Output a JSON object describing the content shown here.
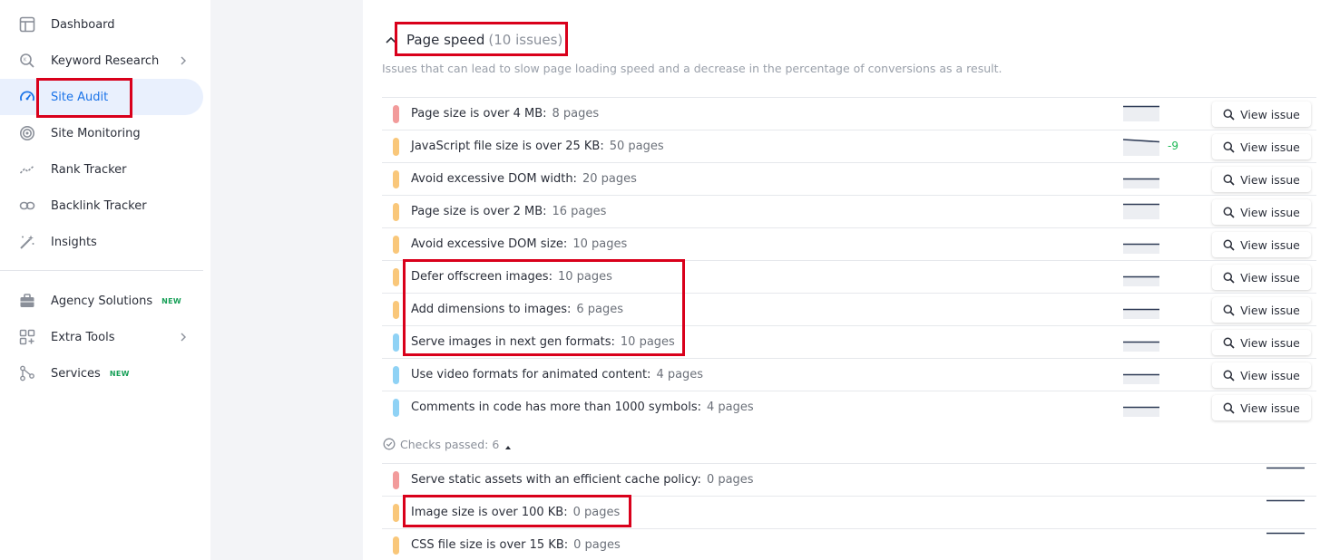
{
  "sidebar": {
    "items": [
      {
        "label": "Dashboard",
        "icon": "table-icon"
      },
      {
        "label": "Keyword Research",
        "icon": "keyword-search-icon",
        "chevron": true
      },
      {
        "label": "Site Audit",
        "icon": "speedometer-icon",
        "active": true
      },
      {
        "label": "Site Monitoring",
        "icon": "target-icon"
      },
      {
        "label": "Rank Tracker",
        "icon": "trend-line-icon"
      },
      {
        "label": "Backlink Tracker",
        "icon": "link-icon"
      },
      {
        "label": "Insights",
        "icon": "magic-wand-icon"
      }
    ],
    "items2": [
      {
        "label": "Agency Solutions",
        "icon": "briefcase-icon",
        "badge": "NEW"
      },
      {
        "label": "Extra Tools",
        "icon": "apps-icon",
        "chevron": true
      },
      {
        "label": "Services",
        "icon": "nodes-icon",
        "badge": "NEW"
      }
    ]
  },
  "section": {
    "title": "Page speed",
    "count": "(10 issues)",
    "description": "Issues that can lead to slow page loading speed and a decrease in the percentage of conversions as a result."
  },
  "issues": [
    {
      "text": "Page size is over 4 MB:",
      "pages": "8 pages",
      "severity": "red",
      "trend": "flat-high",
      "delta": ""
    },
    {
      "text": "JavaScript file size is over 25 KB:",
      "pages": "50 pages",
      "severity": "orange",
      "trend": "down-slight",
      "delta": "-9"
    },
    {
      "text": "Avoid excessive DOM width:",
      "pages": "20 pages",
      "severity": "orange",
      "trend": "flat-mid",
      "delta": ""
    },
    {
      "text": "Page size is over 2 MB:",
      "pages": "16 pages",
      "severity": "orange",
      "trend": "flat-high",
      "delta": ""
    },
    {
      "text": "Avoid excessive DOM size:",
      "pages": "10 pages",
      "severity": "orange",
      "trend": "flat-mid",
      "delta": ""
    },
    {
      "text": "Defer offscreen images:",
      "pages": "10 pages",
      "severity": "orange",
      "trend": "flat-mid",
      "delta": ""
    },
    {
      "text": "Add dimensions to images:",
      "pages": "6 pages",
      "severity": "orange",
      "trend": "flat-mid",
      "delta": ""
    },
    {
      "text": "Serve images in next gen formats:",
      "pages": "10 pages",
      "severity": "blue",
      "trend": "flat-mid",
      "delta": ""
    },
    {
      "text": "Use video formats for animated content:",
      "pages": "4 pages",
      "severity": "blue",
      "trend": "flat-mid",
      "delta": ""
    },
    {
      "text": "Comments in code has more than 1000 symbols:",
      "pages": "4 pages",
      "severity": "blue",
      "trend": "flat-mid",
      "delta": ""
    }
  ],
  "view_issue_label": "View issue",
  "checks_passed": "Checks passed: 6",
  "passed": [
    {
      "text": "Serve static assets with an efficient cache policy:",
      "pages": "0 pages",
      "severity": "red"
    },
    {
      "text": "Image size is over 100 KB:",
      "pages": "0 pages",
      "severity": "orange"
    },
    {
      "text": "CSS file size is over 15 KB:",
      "pages": "0 pages",
      "severity": "orange"
    }
  ],
  "colors": {
    "accent": "#1a73e8",
    "highlight": "#d9001b",
    "red": "#f29b9b",
    "orange": "#f9c77a",
    "blue": "#8fd2f5",
    "positive": "#1db954"
  }
}
